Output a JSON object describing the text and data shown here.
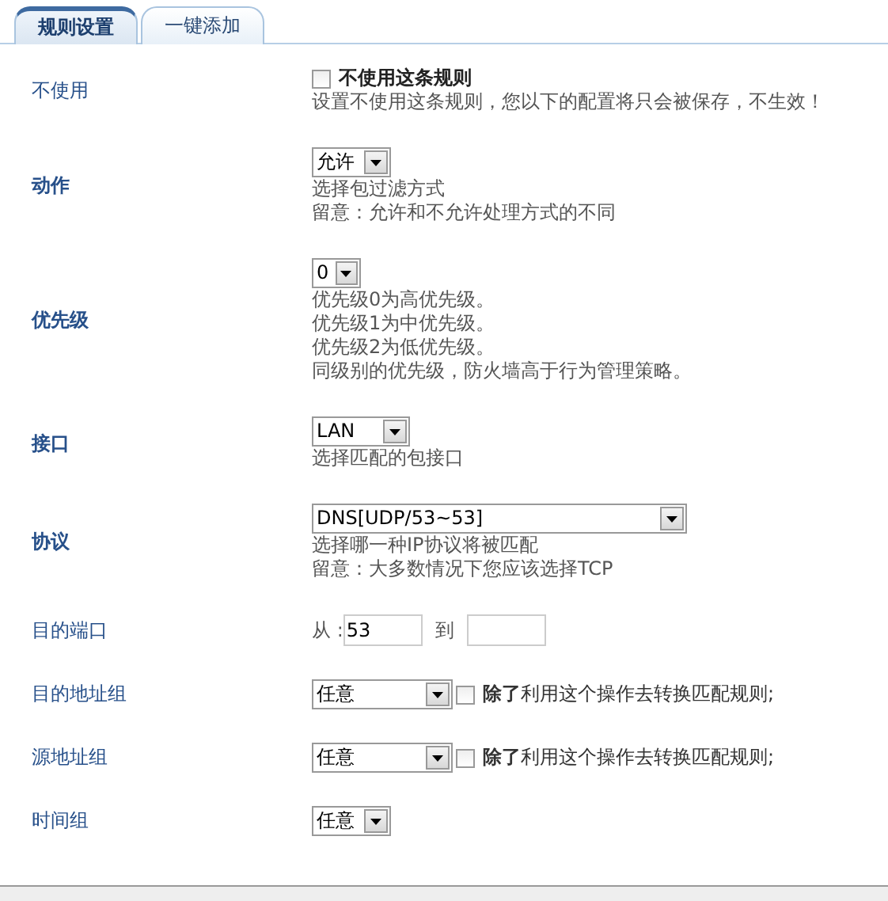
{
  "tabs": [
    {
      "label": "规则设置",
      "selected": true
    },
    {
      "label": "一键添加",
      "selected": false
    }
  ],
  "rows": [
    {
      "kind": "checkbox",
      "label": "不使用",
      "emphasis": false,
      "checked": false,
      "option": "不使用这条规则",
      "hints": [
        "设置不使用这条规则，您以下的配置将只会被保存，不生效！"
      ]
    },
    {
      "kind": "select",
      "label": "动作",
      "emphasis": true,
      "value": "允许",
      "hints": [
        "选择包过滤方式",
        "留意：允许和不允许处理方式的不同"
      ]
    },
    {
      "kind": "select",
      "label": "优先级",
      "emphasis": true,
      "value": "0",
      "hints": [
        "优先级0为高优先级。",
        "优先级1为中优先级。",
        "优先级2为低优先级。",
        "同级别的优先级，防火墙高于行为管理策略。"
      ]
    },
    {
      "kind": "select",
      "label": "接口",
      "emphasis": true,
      "value": "LAN",
      "hints": [
        "选择匹配的包接口"
      ]
    },
    {
      "kind": "select",
      "label": "协议",
      "emphasis": true,
      "value": "DNS[UDP/53~53]",
      "hints": [
        "选择哪一种IP协议将被匹配",
        "留意：大多数情况下您应该选择TCP"
      ]
    },
    {
      "kind": "ports",
      "label": "目的端口",
      "emphasis": false,
      "from_label": "从 :",
      "from_value": "53",
      "to_label": "到"
    },
    {
      "kind": "group",
      "label": "目的地址组",
      "emphasis": false,
      "value": "任意",
      "checked": false,
      "option": "**除了**利用这个操作去转换匹配规则;"
    },
    {
      "kind": "group",
      "label": "源地址组",
      "emphasis": false,
      "value": "任意",
      "checked": false,
      "option": "**除了**利用这个操作去转换匹配规则;"
    },
    {
      "kind": "select",
      "label": "时间组",
      "emphasis": false,
      "value": "任意"
    }
  ]
}
